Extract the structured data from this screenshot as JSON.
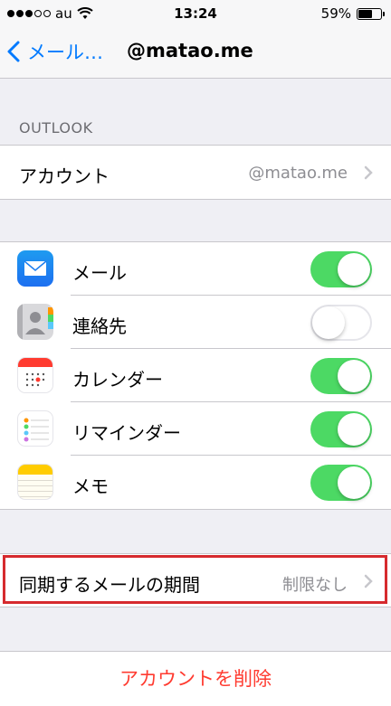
{
  "status_bar": {
    "carrier": "au",
    "time": "13:24",
    "battery": "59%",
    "battery_level": 0.59
  },
  "nav": {
    "back_label": "メール…",
    "title": "@matao.me"
  },
  "section": {
    "header": "OUTLOOK"
  },
  "account": {
    "label": "アカウント",
    "value": "@matao.me"
  },
  "services": [
    {
      "label": "メール",
      "icon": "mail-app-icon",
      "enabled": true
    },
    {
      "label": "連絡先",
      "icon": "contacts-app-icon",
      "enabled": false
    },
    {
      "label": "カレンダー",
      "icon": "calendar-app-icon",
      "enabled": true
    },
    {
      "label": "リマインダー",
      "icon": "reminders-app-icon",
      "enabled": true
    },
    {
      "label": "メモ",
      "icon": "notes-app-icon",
      "enabled": true
    }
  ],
  "sync": {
    "label": "同期するメールの期間",
    "value": "制限なし"
  },
  "delete_label": "アカウントを削除",
  "colors": {
    "accent": "#007aff",
    "toggle_on": "#4cd964",
    "destructive": "#ff3b30",
    "highlight": "#d62a2e"
  }
}
